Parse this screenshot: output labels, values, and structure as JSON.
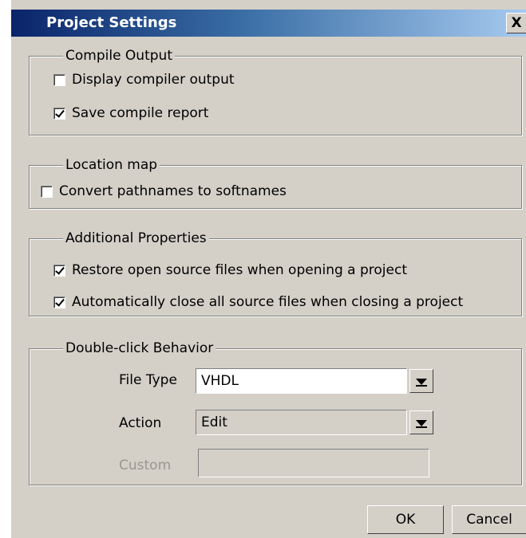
{
  "window": {
    "title": "Project Settings",
    "close_label": "X"
  },
  "compile_output": {
    "legend": "Compile Output",
    "items": [
      {
        "label": "Display compiler output",
        "checked": false
      },
      {
        "label": "Save compile report",
        "checked": true
      }
    ]
  },
  "location_map": {
    "legend": "Location map",
    "items": [
      {
        "label": "Convert pathnames to softnames",
        "checked": false
      }
    ]
  },
  "additional_properties": {
    "legend": "Additional Properties",
    "items": [
      {
        "label": "Restore open source files when opening a project",
        "checked": true
      },
      {
        "label": "Automatically close all source files when closing a project",
        "checked": true
      }
    ]
  },
  "double_click": {
    "legend": "Double-click Behavior",
    "file_type_label": "File Type",
    "file_type_value": "VHDL",
    "action_label": "Action",
    "action_value": "Edit",
    "custom_label": "Custom",
    "custom_value": ""
  },
  "buttons": {
    "ok": "OK",
    "cancel": "Cancel"
  }
}
